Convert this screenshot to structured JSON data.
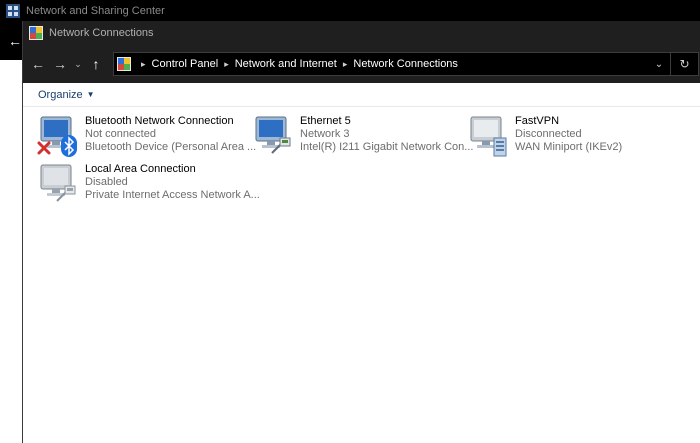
{
  "background_window": {
    "title": "Network and Sharing Center",
    "back_icon": "arrow-left-icon"
  },
  "window": {
    "title": "Network Connections"
  },
  "navigation": {
    "back_icon": "arrow-left-icon",
    "forward_icon": "arrow-right-icon",
    "recent_icon": "chevron-down-icon",
    "up_icon": "arrow-up-icon",
    "breadcrumbs": [
      "Control Panel",
      "Network and Internet",
      "Network Connections"
    ],
    "refresh_icon": "refresh-icon"
  },
  "commandbar": {
    "organize_label": "Organize"
  },
  "connections": [
    {
      "name": "Bluetooth Network Connection",
      "status": "Not connected",
      "device": "Bluetooth Device (Personal Area ...",
      "icon": "network-adapter-icon",
      "overlays": [
        "red-x-icon",
        "bluetooth-icon"
      ]
    },
    {
      "name": "Ethernet 5",
      "status": "Network 3",
      "device": "Intel(R) I211 Gigabit Network Con...",
      "icon": "network-adapter-icon",
      "overlays": [
        "ethernet-cable-icon"
      ]
    },
    {
      "name": "FastVPN",
      "status": "Disconnected",
      "device": "WAN Miniport (IKEv2)",
      "icon": "vpn-adapter-icon",
      "overlays": [
        "server-icon"
      ]
    },
    {
      "name": "Local Area Connection",
      "status": "Disabled",
      "device": "Private Internet Access Network A...",
      "icon": "network-adapter-disabled-icon",
      "overlays": [
        "ethernet-cable-icon"
      ]
    }
  ],
  "colors": {
    "titlebar_bg": "#1f1f1f",
    "link_blue": "#1a3e6e",
    "status_gray": "#6d6d6d",
    "error_red": "#d32f2f",
    "bluetooth_blue": "#1e6fd9"
  }
}
